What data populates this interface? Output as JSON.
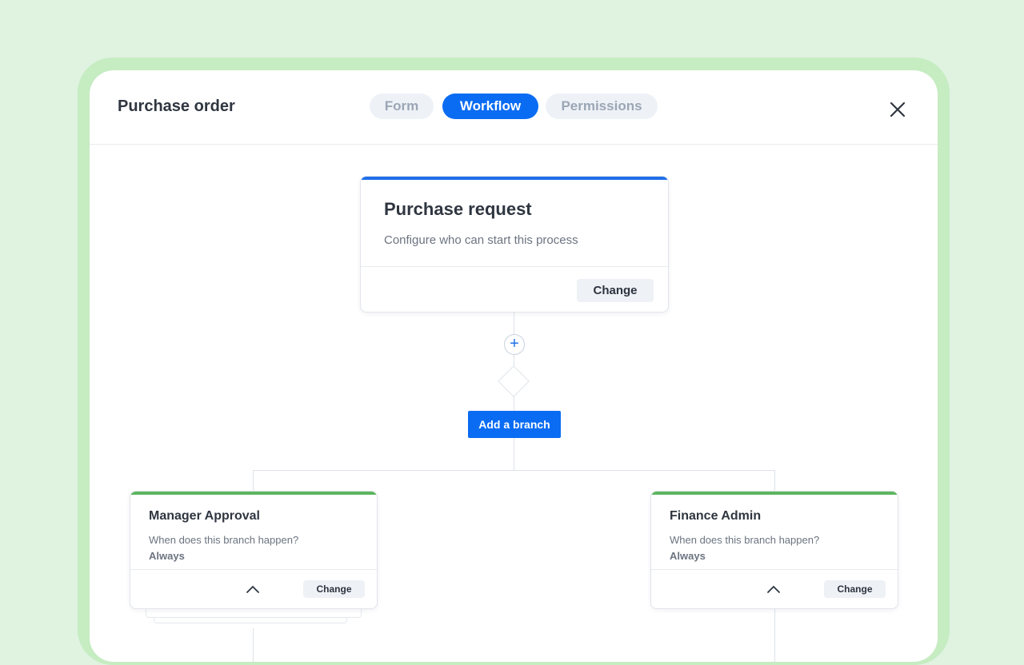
{
  "window": {
    "title": "Purchase order"
  },
  "tabs": [
    {
      "label": "Form",
      "active": false
    },
    {
      "label": "Workflow",
      "active": true
    },
    {
      "label": "Permissions",
      "active": false
    }
  ],
  "icons": {
    "close": "close-icon",
    "plus": "plus-icon",
    "chevron": "chevron-up-icon"
  },
  "colors": {
    "accent": "#0a6cf2",
    "start_bar": "#1f6fe8",
    "branch_bar": "#5db65f",
    "background": "#dff3e0"
  },
  "start_step": {
    "title": "Purchase request",
    "subtitle": "Configure who can start this process",
    "change_label": "Change"
  },
  "add_branch_label": "Add a branch",
  "branches": [
    {
      "title": "Manager Approval",
      "question": "When does this branch happen?",
      "answer": "Always",
      "change_label": "Change"
    },
    {
      "title": "Finance Admin",
      "question": "When does this branch happen?",
      "answer": "Always",
      "change_label": "Change"
    }
  ]
}
